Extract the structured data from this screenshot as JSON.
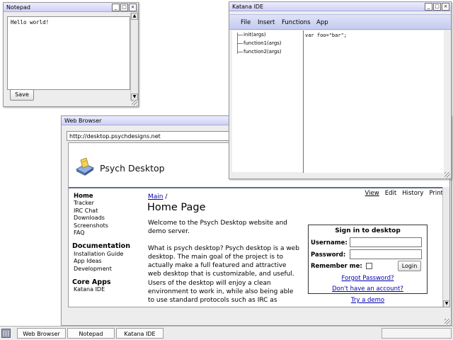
{
  "notepad": {
    "title": "Notepad",
    "text": "Hello world!",
    "save_label": "Save"
  },
  "katana": {
    "title": "Katana IDE",
    "menu": [
      "File",
      "Insert",
      "Functions",
      "App"
    ],
    "tree": [
      "init(args)",
      "function1(args)",
      "function2(args)"
    ],
    "code": "var foo=\"bar\";"
  },
  "browser": {
    "title": "Web Browser",
    "url": "http://desktop.psychdesigns.net",
    "site_name": "Psych Desktop",
    "nav_main": [
      "Home",
      "Tracker",
      "IRC Chat",
      "Downloads",
      "Screenshots",
      "FAQ"
    ],
    "doc_heading": "Documentation",
    "doc_links": [
      "Installation Guide",
      "App Ideas",
      "Development"
    ],
    "apps_heading": "Core Apps",
    "apps_links": [
      "Katana IDE"
    ],
    "crumb_main": "Main",
    "crumb_sep": "/",
    "page_tabs": [
      "View",
      "Edit",
      "History",
      "Print"
    ],
    "page_title": "Home Page",
    "para1": "Welcome to the Psych Desktop website and demo server.",
    "para2": "What is psych desktop? Psych desktop is a web desktop. The main goal of the project is to actually make a full featured and attractive web desktop that is customizable, and useful. Users of the desktop will enjoy a clean environment to work in, while also being able to use standard protocols such as IRC as",
    "signin": {
      "title": "Sign in to desktop",
      "username_label": "Username:",
      "password_label": "Password:",
      "remember_label": "Remember me:",
      "login_label": "Login",
      "forgot": "Forgot Password?",
      "no_account": "Don't have an account?",
      "try_demo": "Try a demo"
    }
  },
  "taskbar": {
    "items": [
      "Web Browser",
      "Notepad",
      "Katana IDE"
    ]
  }
}
